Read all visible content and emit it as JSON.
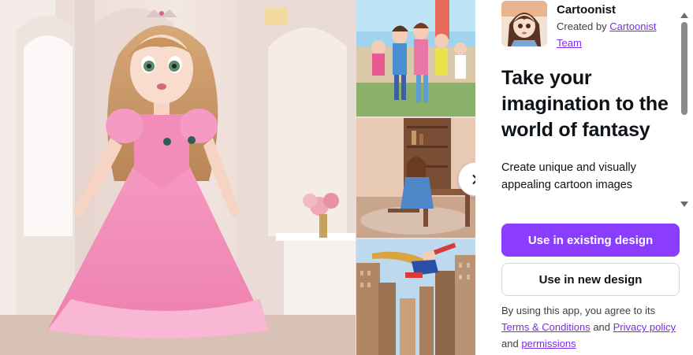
{
  "app": {
    "name": "Cartoonist",
    "created_by_prefix": "Created by ",
    "creator": "Cartoonist Team"
  },
  "content": {
    "headline": "Take your imagination to the world of fantasy",
    "description": "Create unique and visually appealing cartoon images"
  },
  "actions": {
    "primary_label": "Use in existing design",
    "secondary_label": "Use in new design"
  },
  "terms": {
    "prefix": "By using this app, you agree to its ",
    "terms_link": "Terms & Conditions",
    "and_1": " and ",
    "privacy_link": "Privacy policy",
    "and_2": " and ",
    "permissions_link": "permissions"
  },
  "colors": {
    "brand_purple": "#8b3dff",
    "link_purple": "#7d2ae8",
    "text_dark": "#0e1318"
  },
  "icons": {
    "next": "chevron-right-icon"
  }
}
